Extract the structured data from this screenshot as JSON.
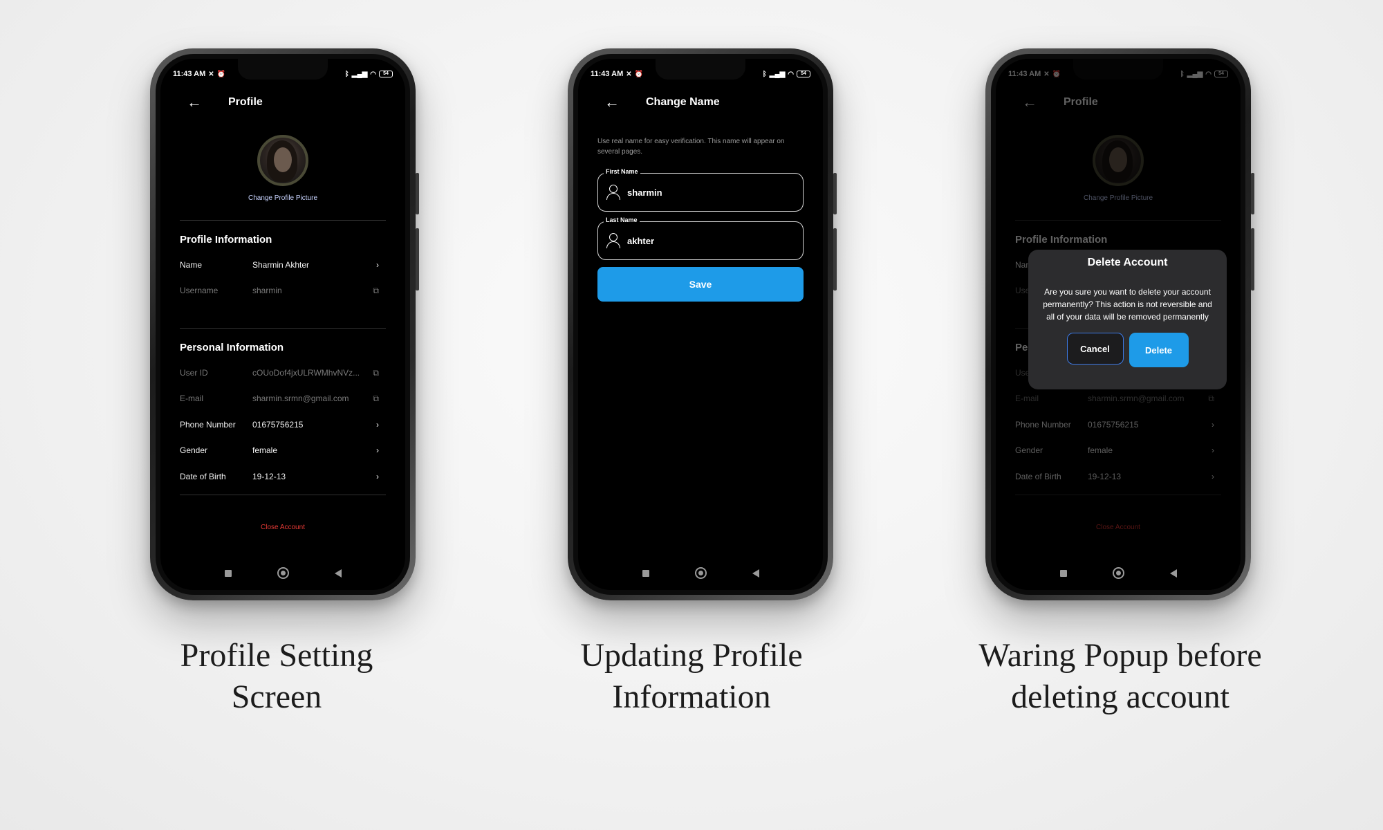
{
  "status_bar": {
    "time": "11:43 AM",
    "battery": "54"
  },
  "profile_screen": {
    "title": "Profile",
    "change_picture": "Change Profile Picture",
    "profile_section": "Profile Information",
    "profile_rows": [
      {
        "label": "Name",
        "value": "Sharmin Akhter",
        "icon": "chevron-right",
        "editable": true
      },
      {
        "label": "Username",
        "value": "sharmin",
        "icon": "copy",
        "editable": false
      }
    ],
    "personal_section": "Personal Information",
    "personal_rows": [
      {
        "label": "User ID",
        "value": "cOUoDof4jxULRWMhvNVz...",
        "icon": "copy",
        "editable": false
      },
      {
        "label": "E-mail",
        "value": "sharmin.srmn@gmail.com",
        "icon": "copy",
        "editable": false
      },
      {
        "label": "Phone Number",
        "value": "01675756215",
        "icon": "chevron-right",
        "editable": true
      },
      {
        "label": "Gender",
        "value": "female",
        "icon": "chevron-right",
        "editable": true
      },
      {
        "label": "Date of Birth",
        "value": "19-12-13",
        "icon": "chevron-right",
        "editable": true
      }
    ],
    "close_account": "Close Account"
  },
  "change_name_screen": {
    "title": "Change Name",
    "hint": "Use real name for easy verification. This name will appear on several pages.",
    "first_name": {
      "label": "First Name",
      "value": "sharmin"
    },
    "last_name": {
      "label": "Last Name",
      "value": "akhter"
    },
    "save_label": "Save"
  },
  "delete_dialog": {
    "title": "Delete Account",
    "message": "Are you sure you want to delete your account permanently? This action is not reversible and all of your data will be removed permanently",
    "cancel_label": "Cancel",
    "delete_label": "Delete"
  },
  "captions": {
    "one": "Profile Setting Screen",
    "two": "Updating Profile Information",
    "three": "Waring Popup before deleting account"
  },
  "colors": {
    "accent_blue": "#1e9be8",
    "danger_red": "#e53935",
    "screen_bg": "#000000",
    "page_bg": "#f1f1f1"
  }
}
